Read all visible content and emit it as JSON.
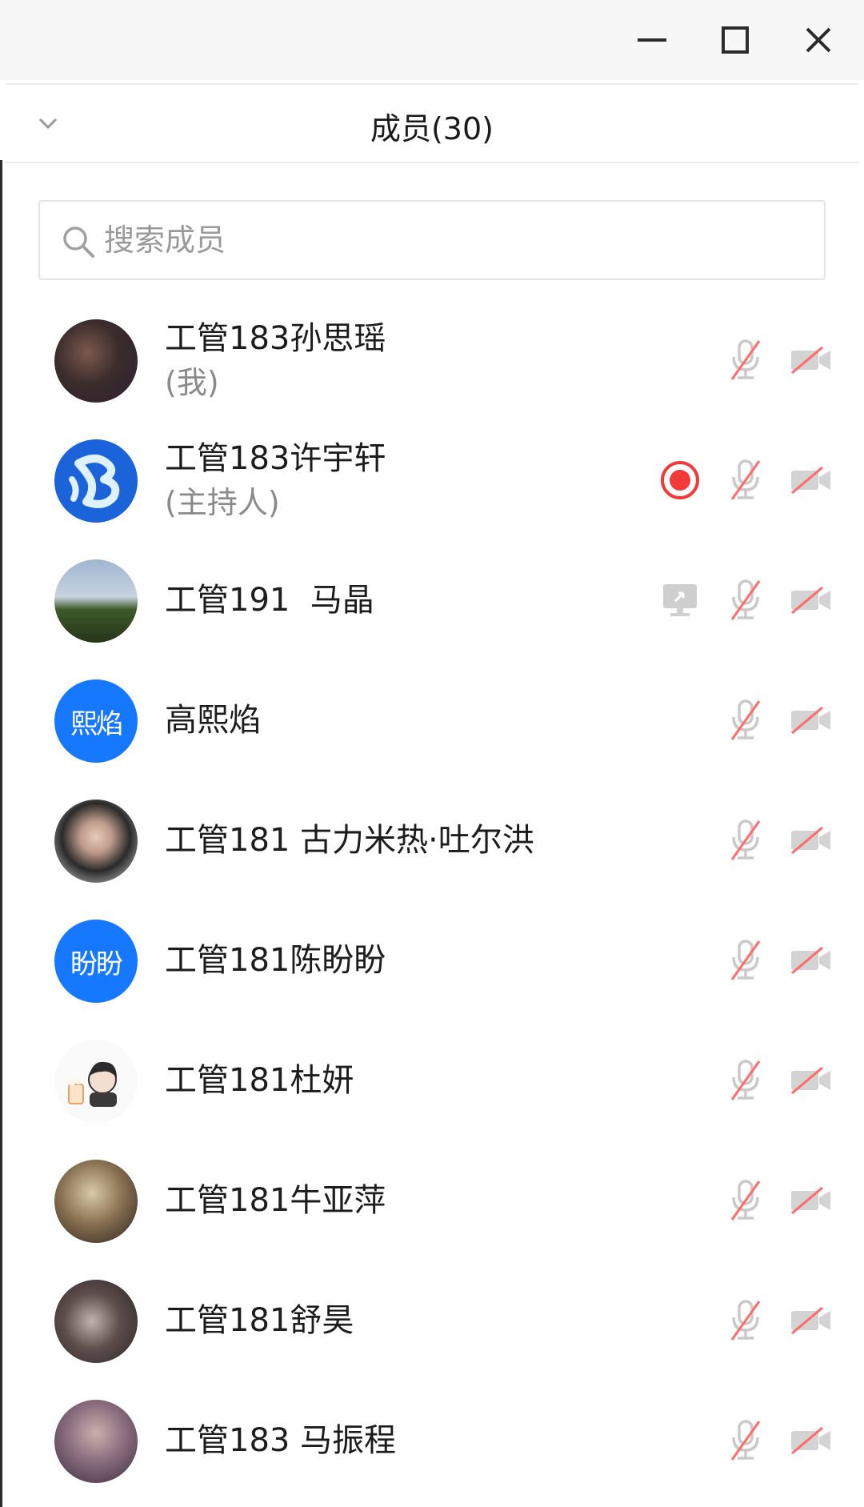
{
  "window": {
    "minimize_icon": "minimize-icon",
    "maximize_icon": "maximize-icon",
    "close_icon": "close-icon"
  },
  "header": {
    "title": "成员(30)",
    "collapse_icon": "chevron-down-icon"
  },
  "search": {
    "placeholder": "搜索成员",
    "value": ""
  },
  "colors": {
    "accent_blue": "#1677ff",
    "record_red": "#f33a3a",
    "muted_icon_gray": "#c9c9c9",
    "muted_slash_red": "#ff6b6b"
  },
  "members": [
    {
      "name": "工管183孙思瑶",
      "role": "(我)",
      "avatar": "photo",
      "mic": "muted",
      "camera": "off"
    },
    {
      "name": "工管183许宇轩",
      "role": "(主持人)",
      "avatar": "logo",
      "recording": true,
      "mic": "muted",
      "camera": "off"
    },
    {
      "name": "工管191  马晶",
      "role": "",
      "avatar": "photo",
      "screen_share": true,
      "mic": "muted",
      "camera": "off"
    },
    {
      "name": "高熙焰",
      "role": "",
      "avatar_text": "熙焰",
      "mic": "muted",
      "camera": "off"
    },
    {
      "name": "工管181 古力米热·吐尔洪",
      "role": "",
      "avatar": "photo",
      "mic": "muted",
      "camera": "off"
    },
    {
      "name": "工管181陈盼盼",
      "role": "",
      "avatar_text": "盼盼",
      "mic": "muted",
      "camera": "off"
    },
    {
      "name": "工管181杜妍",
      "role": "",
      "avatar": "cartoon",
      "mic": "muted",
      "camera": "off"
    },
    {
      "name": "工管181牛亚萍",
      "role": "",
      "avatar": "photo",
      "mic": "muted",
      "camera": "off"
    },
    {
      "name": "工管181舒昊",
      "role": "",
      "avatar": "photo",
      "mic": "muted",
      "camera": "off"
    },
    {
      "name": "工管183 马振程",
      "role": "",
      "avatar": "photo",
      "mic": "muted",
      "camera": "off"
    }
  ]
}
